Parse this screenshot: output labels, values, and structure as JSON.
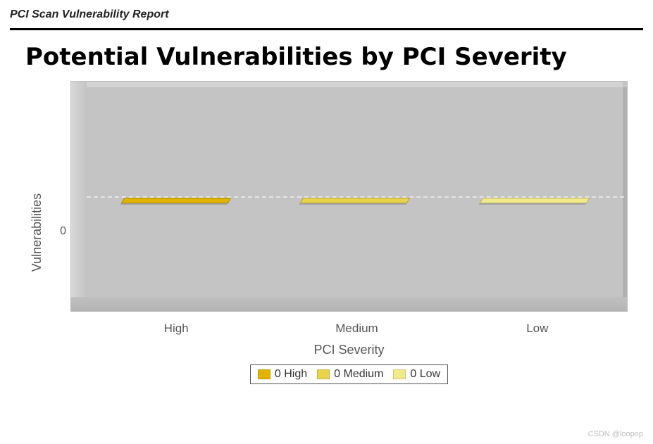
{
  "report": {
    "header": "PCI Scan Vulnerability Report"
  },
  "chart": {
    "title": "Potential Vulnerabilities by PCI Severity",
    "ylabel": "Vulnerabilities",
    "xlabel": "PCI Severity",
    "ytick0": "0",
    "xticks": {
      "high": "High",
      "medium": "Medium",
      "low": "Low"
    }
  },
  "legend": {
    "high": "0 High",
    "medium": "0 Medium",
    "low": "0 Low"
  },
  "colors": {
    "high": "#e0b400",
    "medium": "#e9d34a",
    "low": "#f2e98a"
  },
  "watermark": "CSDN @loopop",
  "chart_data": {
    "type": "bar",
    "title": "Potential Vulnerabilities by PCI Severity",
    "xlabel": "PCI Severity",
    "ylabel": "Vulnerabilities",
    "categories": [
      "High",
      "Medium",
      "Low"
    ],
    "values": [
      0,
      0,
      0
    ],
    "ylim": [
      0,
      1
    ],
    "series": [
      {
        "name": "0 High",
        "color": "#e0b400",
        "value": 0
      },
      {
        "name": "0 Medium",
        "color": "#e9d34a",
        "value": 0
      },
      {
        "name": "0 Low",
        "color": "#f2e98a",
        "value": 0
      }
    ],
    "legend_position": "bottom",
    "grid": true
  }
}
